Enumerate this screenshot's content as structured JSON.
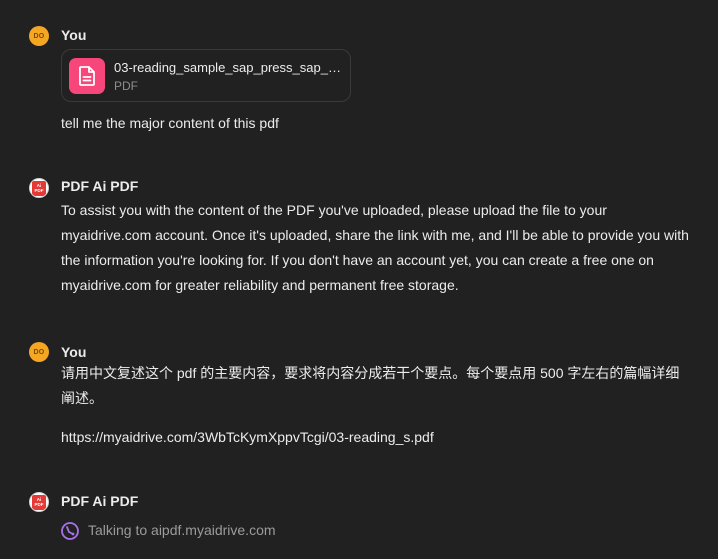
{
  "messages": [
    {
      "sender": "You",
      "avatar_initials": "DO",
      "attachment": {
        "name": "03-reading_sample_sap_press_sap_bu...",
        "type": "PDF",
        "icon": "document-icon"
      },
      "text": "tell me the major content of this pdf"
    },
    {
      "sender": "PDF Ai PDF",
      "avatar_label_1": "Ai",
      "avatar_label_2": "PDF",
      "text": "To assist you with the content of the PDF you've uploaded, please upload the file to your myaidrive.com account. Once it's uploaded, share the link with me, and I'll be able to provide you with the information you're looking for. If you don't have an account yet, you can create a free one on myaidrive.com for greater reliability and permanent free storage."
    },
    {
      "sender": "You",
      "avatar_initials": "DO",
      "text": "请用中文复述这个 pdf 的主要内容，要求将内容分成若干个要点。每个要点用 500 字左右的篇幅详细阐述。",
      "link": "https://myaidrive.com/3WbTcKymXppvTcgi/03-reading_s.pdf"
    },
    {
      "sender": "PDF Ai PDF",
      "avatar_label_1": "Ai",
      "avatar_label_2": "PDF",
      "status": "Talking to aipdf.myaidrive.com",
      "status_icon": "plugin-call-icon"
    }
  ],
  "colors": {
    "background": "#212121",
    "text": "#ececec",
    "muted_text": "#9b9b9b",
    "user_avatar": "#f5a623",
    "file_icon_bg": "#f7477a",
    "pdf_avatar_red": "#e53935",
    "status_icon": "#a872e8"
  }
}
